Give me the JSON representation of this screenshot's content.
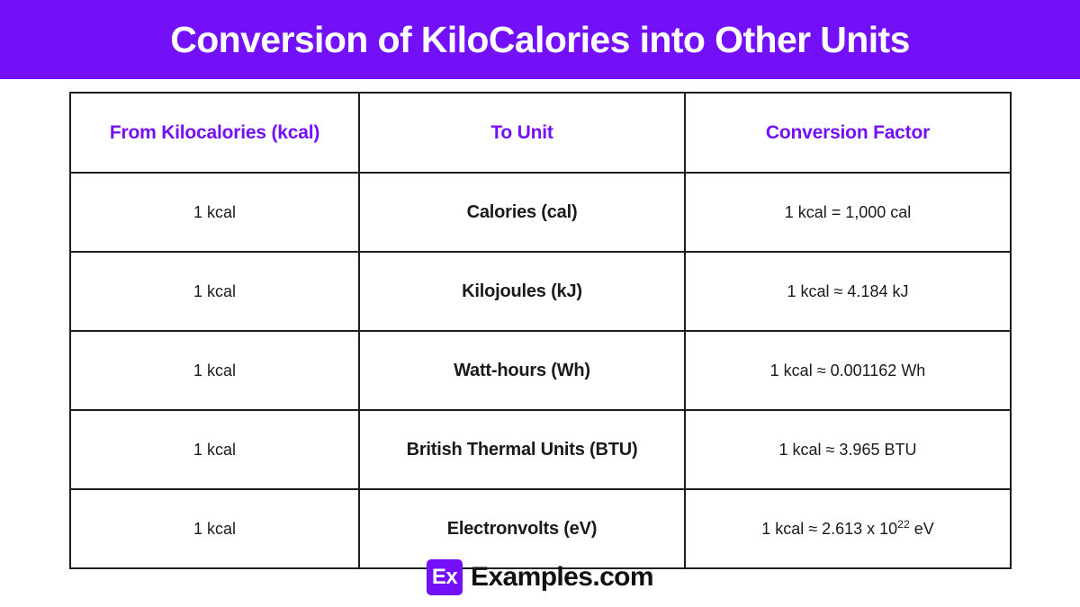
{
  "banner": {
    "title": "Conversion of KiloCalories into Other Units",
    "background_color": "#7410f8",
    "text_color": "#ffffff"
  },
  "table": {
    "accent_color": "#7410f8",
    "border_color": "#1d1d1d",
    "headers": [
      "From Kilocalories (kcal)",
      "To Unit",
      "Conversion Factor"
    ],
    "rows": [
      {
        "from": "1 kcal",
        "unit": "Calories (cal)",
        "factor_prefix": "1 kcal = 1,000 cal",
        "factor_sup": "",
        "factor_suffix": ""
      },
      {
        "from": "1 kcal",
        "unit": "Kilojoules (kJ)",
        "factor_prefix": "1 kcal ≈ 4.184 kJ",
        "factor_sup": "",
        "factor_suffix": ""
      },
      {
        "from": "1 kcal",
        "unit": "Watt-hours (Wh)",
        "factor_prefix": "1 kcal ≈ 0.001162 Wh",
        "factor_sup": "",
        "factor_suffix": ""
      },
      {
        "from": "1 kcal",
        "unit": "British Thermal Units (BTU)",
        "factor_prefix": "1 kcal ≈ 3.965 BTU",
        "factor_sup": "",
        "factor_suffix": ""
      },
      {
        "from": "1 kcal",
        "unit": "Electronvolts (eV)",
        "factor_prefix": "1 kcal ≈ 2.613 x 10",
        "factor_sup": "22",
        "factor_suffix": " eV"
      }
    ]
  },
  "footer": {
    "logo_mark": "Ex",
    "logo_text": "Examples.com",
    "logo_color": "#7410f8"
  }
}
